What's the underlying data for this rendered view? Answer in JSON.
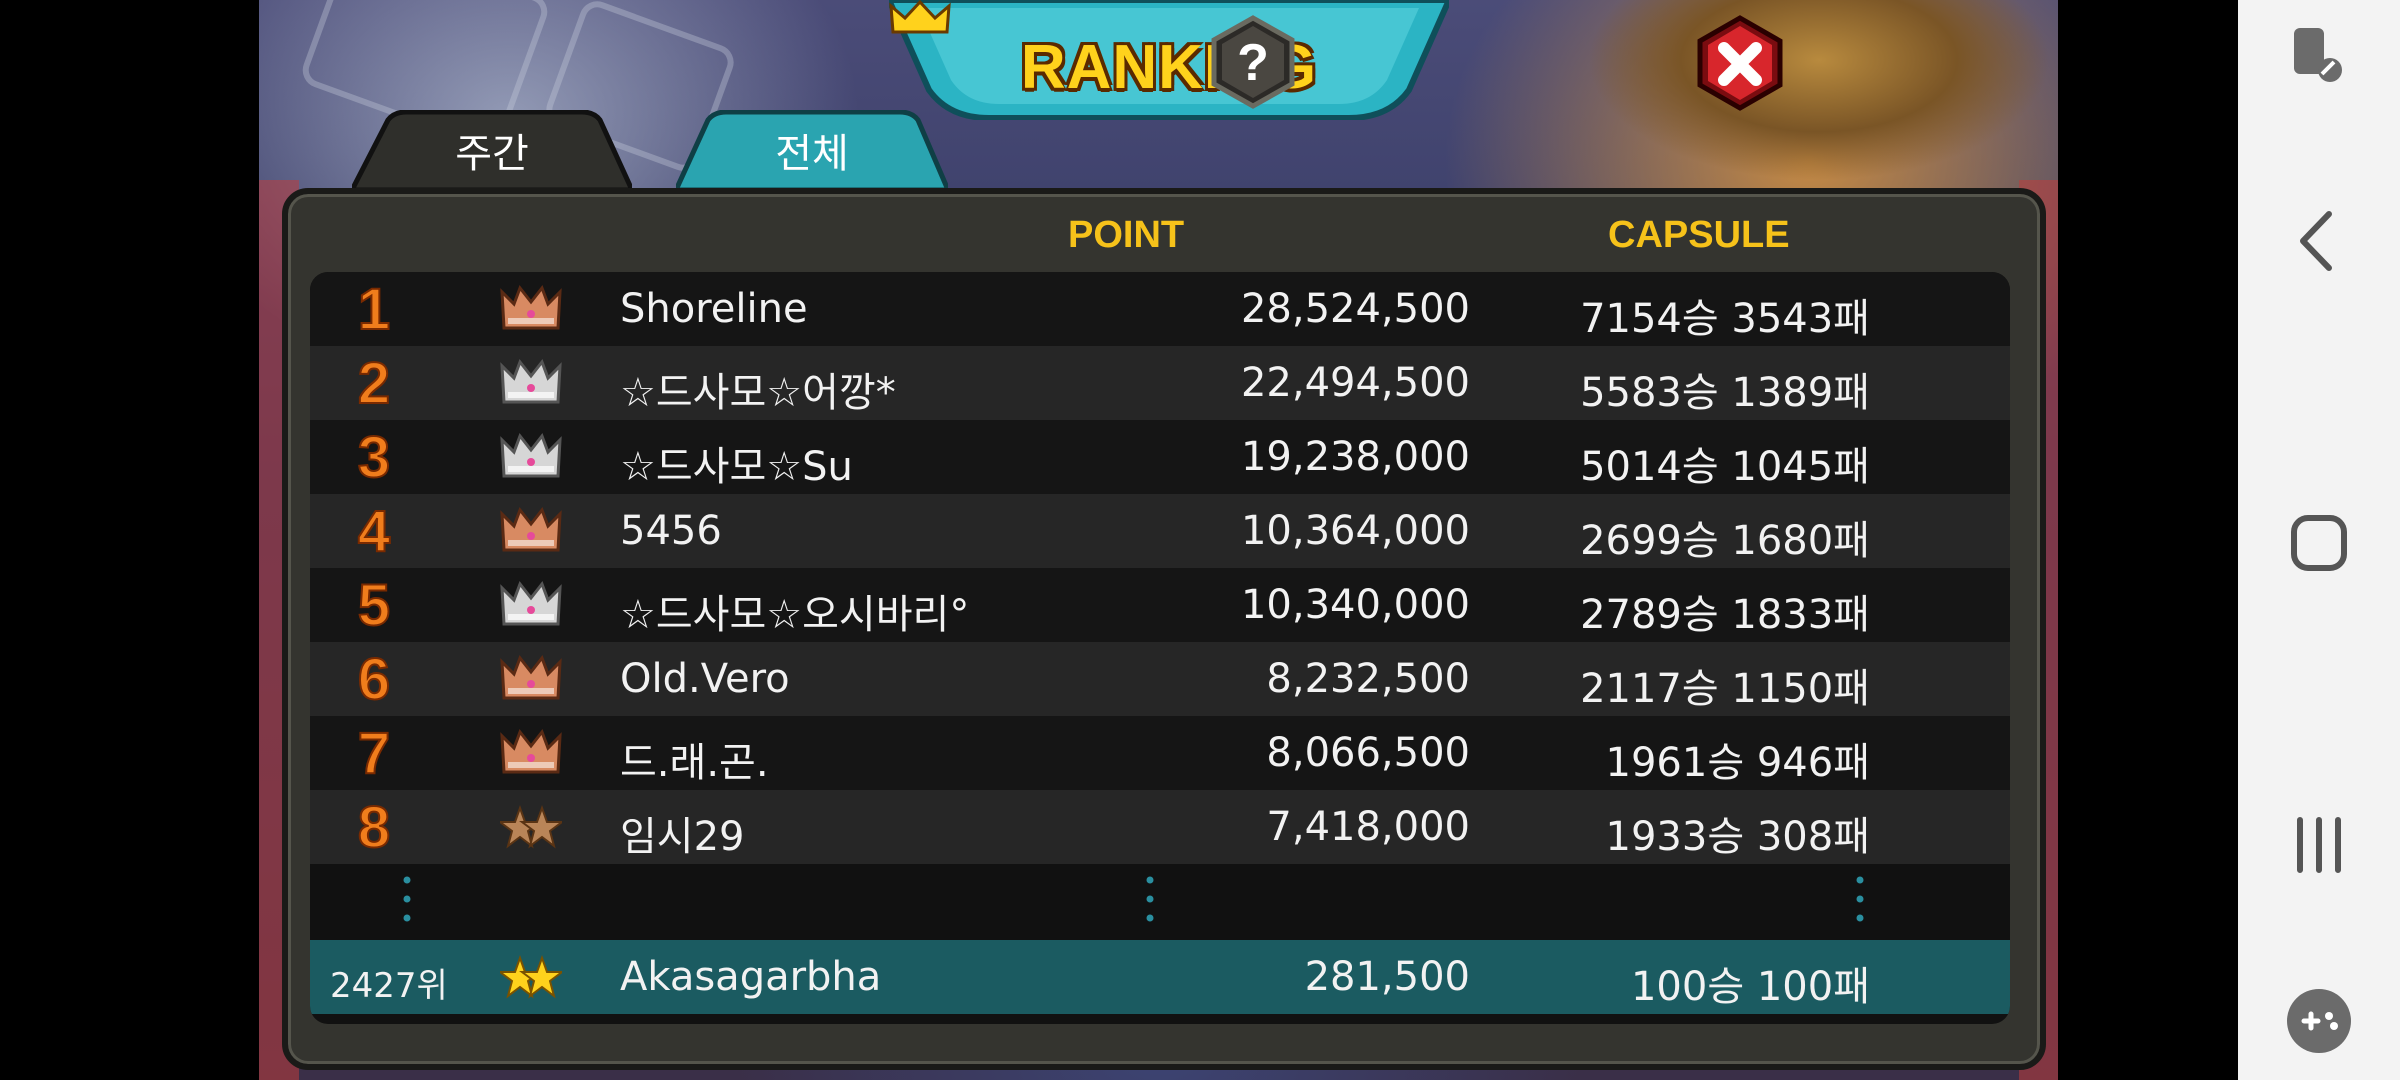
{
  "header": {
    "title": "RANKING"
  },
  "tabs": [
    {
      "label": "주간",
      "active": false
    },
    {
      "label": "전체",
      "active": true
    }
  ],
  "columns": {
    "point": "POINT",
    "capsule": "CAPSULE"
  },
  "rows": [
    {
      "rank": "1",
      "tier": "bronze-crown",
      "name": "Shoreline",
      "point": "28,524,500",
      "capsule": "7154승 3543패"
    },
    {
      "rank": "2",
      "tier": "silver-crown",
      "name": "☆드사모☆어깡*",
      "point": "22,494,500",
      "capsule": "5583승 1389패"
    },
    {
      "rank": "3",
      "tier": "silver-crown",
      "name": "☆드사모☆Su",
      "point": "19,238,000",
      "capsule": "5014승 1045패"
    },
    {
      "rank": "4",
      "tier": "bronze-crown",
      "name": "5456",
      "point": "10,364,000",
      "capsule": "2699승 1680패"
    },
    {
      "rank": "5",
      "tier": "silver-crown",
      "name": "☆드사모☆오시바리°",
      "point": "10,340,000",
      "capsule": "2789승 1833패"
    },
    {
      "rank": "6",
      "tier": "bronze-crown",
      "name": "Old.Vero",
      "point": "8,232,500",
      "capsule": "2117승 1150패"
    },
    {
      "rank": "7",
      "tier": "bronze-crown",
      "name": "드.래.곤.",
      "point": "8,066,500",
      "capsule": "1961승 946패"
    },
    {
      "rank": "8",
      "tier": "bronze-two-star",
      "name": "임시29",
      "point": "7,418,000",
      "capsule": "1933승 308패"
    }
  ],
  "my_row": {
    "rank": "2427위",
    "tier": "gold-two-star",
    "name": "Akasagarbha",
    "point": "281,500",
    "capsule": "100승 100패"
  },
  "colors": {
    "accent_yellow": "#f6c21a",
    "rank_orange": "#f07d1c",
    "active_tab": "#2aa4b0",
    "my_row_bg": "#1b5b61",
    "close_red": "#d8262c"
  },
  "navbar": {
    "icons": [
      "screen-rotate-icon",
      "back-icon",
      "home-icon",
      "recents-icon",
      "game-launcher-icon"
    ]
  }
}
